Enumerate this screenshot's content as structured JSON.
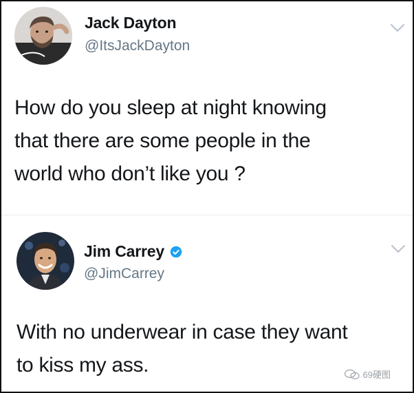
{
  "tweets": [
    {
      "display_name": "Jack Dayton",
      "handle": "@ItsJackDayton",
      "verified": false,
      "avatar_icon": "user-photo",
      "menu_icon": "chevron-down",
      "text_lines": [
        "How do you sleep at night knowing",
        "that there are some people in the",
        "world who don’t like you ?"
      ]
    },
    {
      "display_name": "Jim Carrey",
      "handle": "@JimCarrey",
      "verified": true,
      "avatar_icon": "user-photo",
      "menu_icon": "chevron-down",
      "text_lines": [
        "With no underwear in case they want",
        "to kiss my ass."
      ]
    }
  ],
  "watermark": {
    "text": "69硬图",
    "icon": "wechat-icon"
  },
  "colors": {
    "text": "#14171a",
    "secondary": "#657786",
    "verified": "#1da1f2",
    "border": "#111111"
  }
}
